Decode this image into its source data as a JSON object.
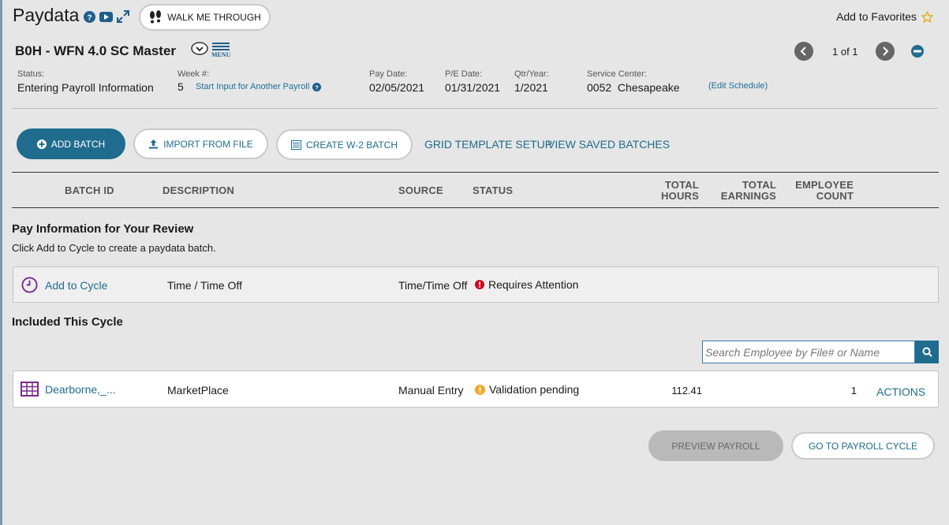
{
  "header": {
    "title": "Paydata",
    "walk_me_label": "WALK ME THROUGH",
    "favorites_label": "Add to Favorites"
  },
  "payroll": {
    "name": "B0H - WFN 4.0 SC Master",
    "menu_label": "MENU",
    "pager_text": "1 of 1"
  },
  "info": {
    "status_label": "Status:",
    "status_value": "Entering Payroll Information",
    "week_label": "Week #:",
    "week_value": "5",
    "start_input_link": "Start Input for Another Payroll",
    "pay_date_label": "Pay Date:",
    "pay_date_value": "02/05/2021",
    "pe_date_label": "P/E Date:",
    "pe_date_value": "01/31/2021",
    "qtr_label": "Qtr/Year:",
    "qtr_value": "1/2021",
    "service_center_label": "Service Center:",
    "service_center_value": "0052  Chesapeake",
    "edit_schedule_link": "(Edit Schedule)"
  },
  "toolbar": {
    "add_batch": "ADD BATCH",
    "import_file": "IMPORT FROM FILE",
    "create_w2": "CREATE W-2 BATCH",
    "grid_template": "GRID TEMPLATE SETUP",
    "view_saved": "VIEW SAVED BATCHES"
  },
  "table": {
    "headers": {
      "batch_id": "BATCH ID",
      "description": "DESCRIPTION",
      "source": "SOURCE",
      "status": "STATUS",
      "total_hours_1": "TOTAL",
      "total_hours_2": "HOURS",
      "total_earnings_1": "TOTAL",
      "total_earnings_2": "EARNINGS",
      "employee_count_1": "EMPLOYEE",
      "employee_count_2": "COUNT"
    }
  },
  "review": {
    "title": "Pay Information for Your Review",
    "subtitle": "Click Add to Cycle to create a paydata batch.",
    "row": {
      "action": "Add to Cycle",
      "description": "Time / Time Off",
      "source": "Time/Time Off",
      "status": "Requires Attention"
    }
  },
  "included": {
    "title": "Included This Cycle",
    "search_placeholder": "Search Employee by File# or Name",
    "row": {
      "batch_id": "Dearborne,_...",
      "description": "MarketPlace",
      "source": "Manual Entry",
      "status": "Validation pending",
      "total_hours": "112.41",
      "employee_count": "1",
      "actions": "ACTIONS"
    }
  },
  "footer": {
    "preview": "PREVIEW PAYROLL",
    "go_to_cycle": "GO TO PAYROLL CYCLE"
  },
  "colors": {
    "accent": "#1f6c8f",
    "error": "#d0021b",
    "warning": "#f5a623",
    "purple": "#7b2c8f"
  },
  "icons": [
    "help-icon",
    "youtube-icon",
    "expand-icon",
    "footprints-icon",
    "star-icon",
    "chevron-down-icon",
    "menu-icon",
    "chevron-left-icon",
    "chevron-right-icon",
    "minus-circle-icon",
    "plus-circle-icon",
    "upload-icon",
    "w2-icon",
    "clock-icon",
    "error-icon",
    "grid-icon",
    "warning-icon",
    "search-icon"
  ]
}
